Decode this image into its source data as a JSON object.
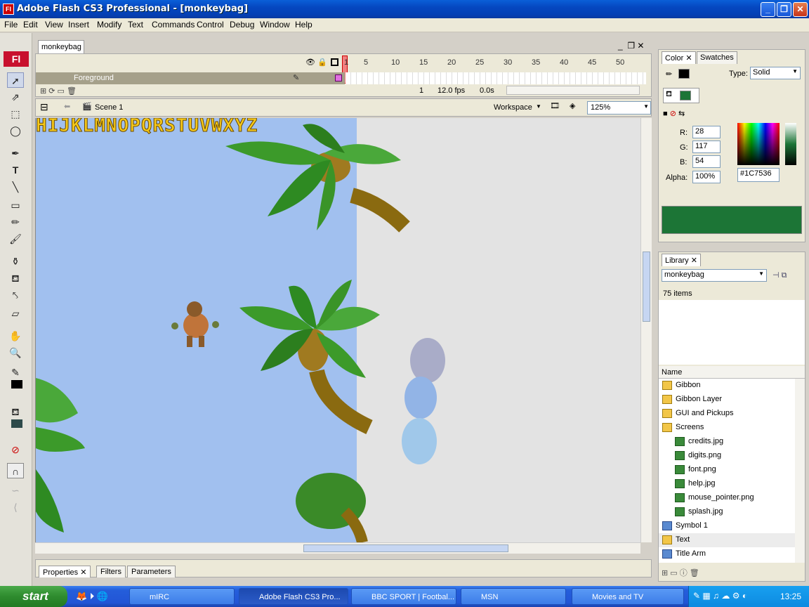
{
  "window": {
    "title": "Adobe Flash CS3 Professional - [monkeybag]",
    "app_icon": "Fl",
    "min_label": "_",
    "max_label": "❐",
    "close_label": "✕"
  },
  "menu": [
    "File",
    "Edit",
    "View",
    "Insert",
    "Modify",
    "Text",
    "Commands",
    "Control",
    "Debug",
    "Window",
    "Help"
  ],
  "document": {
    "tab": "monkeybag",
    "layer_name": "Foreground",
    "frame_numbers": [
      "1",
      "5",
      "10",
      "15",
      "20",
      "25",
      "30",
      "35",
      "40",
      "45",
      "50"
    ],
    "current_frame": "1",
    "fps": "12.0 fps",
    "elapsed": "0.0s",
    "scene": "Scene 1",
    "workspace": "Workspace",
    "zoom": "125%"
  },
  "stage_text": "HIJKLMNOPQRSTUVWXYZ",
  "properties_tabs": [
    "Properties",
    "Filters",
    "Parameters"
  ],
  "color_panel": {
    "tabs": [
      "Color",
      "Swatches"
    ],
    "type_label": "Type:",
    "type_value": "Solid",
    "r_label": "R:",
    "r": "28",
    "g_label": "G:",
    "g": "117",
    "b_label": "B:",
    "b": "54",
    "alpha_label": "Alpha:",
    "alpha": "100%",
    "hex": "#1C7536",
    "fill_color": "#1c7536"
  },
  "library": {
    "tab": "Library",
    "selected": "monkeybag",
    "count": "75 items",
    "column": "Name",
    "items": [
      {
        "name": "Gibbon",
        "kind": "folder",
        "indent": 0
      },
      {
        "name": "Gibbon Layer",
        "kind": "folder",
        "indent": 0
      },
      {
        "name": "GUI and Pickups",
        "kind": "folder",
        "indent": 0
      },
      {
        "name": "Screens",
        "kind": "folder-open",
        "indent": 0
      },
      {
        "name": "credits.jpg",
        "kind": "image",
        "indent": 1
      },
      {
        "name": "digits.png",
        "kind": "image",
        "indent": 1
      },
      {
        "name": "font.png",
        "kind": "image",
        "indent": 1
      },
      {
        "name": "help.jpg",
        "kind": "image",
        "indent": 1
      },
      {
        "name": "mouse_pointer.png",
        "kind": "image",
        "indent": 1
      },
      {
        "name": "splash.jpg",
        "kind": "image",
        "indent": 1
      },
      {
        "name": "Symbol 1",
        "kind": "symbol",
        "indent": 0
      },
      {
        "name": "Text",
        "kind": "folder",
        "indent": 0
      },
      {
        "name": "Title Arm",
        "kind": "symbol",
        "indent": 0
      }
    ]
  },
  "taskbar": {
    "start": "start",
    "tasks": [
      "mIRC",
      "Adobe Flash CS3 Pro...",
      "BBC SPORT | Footbal...",
      "MSN",
      "Movies and TV"
    ],
    "clock": "13:25"
  }
}
